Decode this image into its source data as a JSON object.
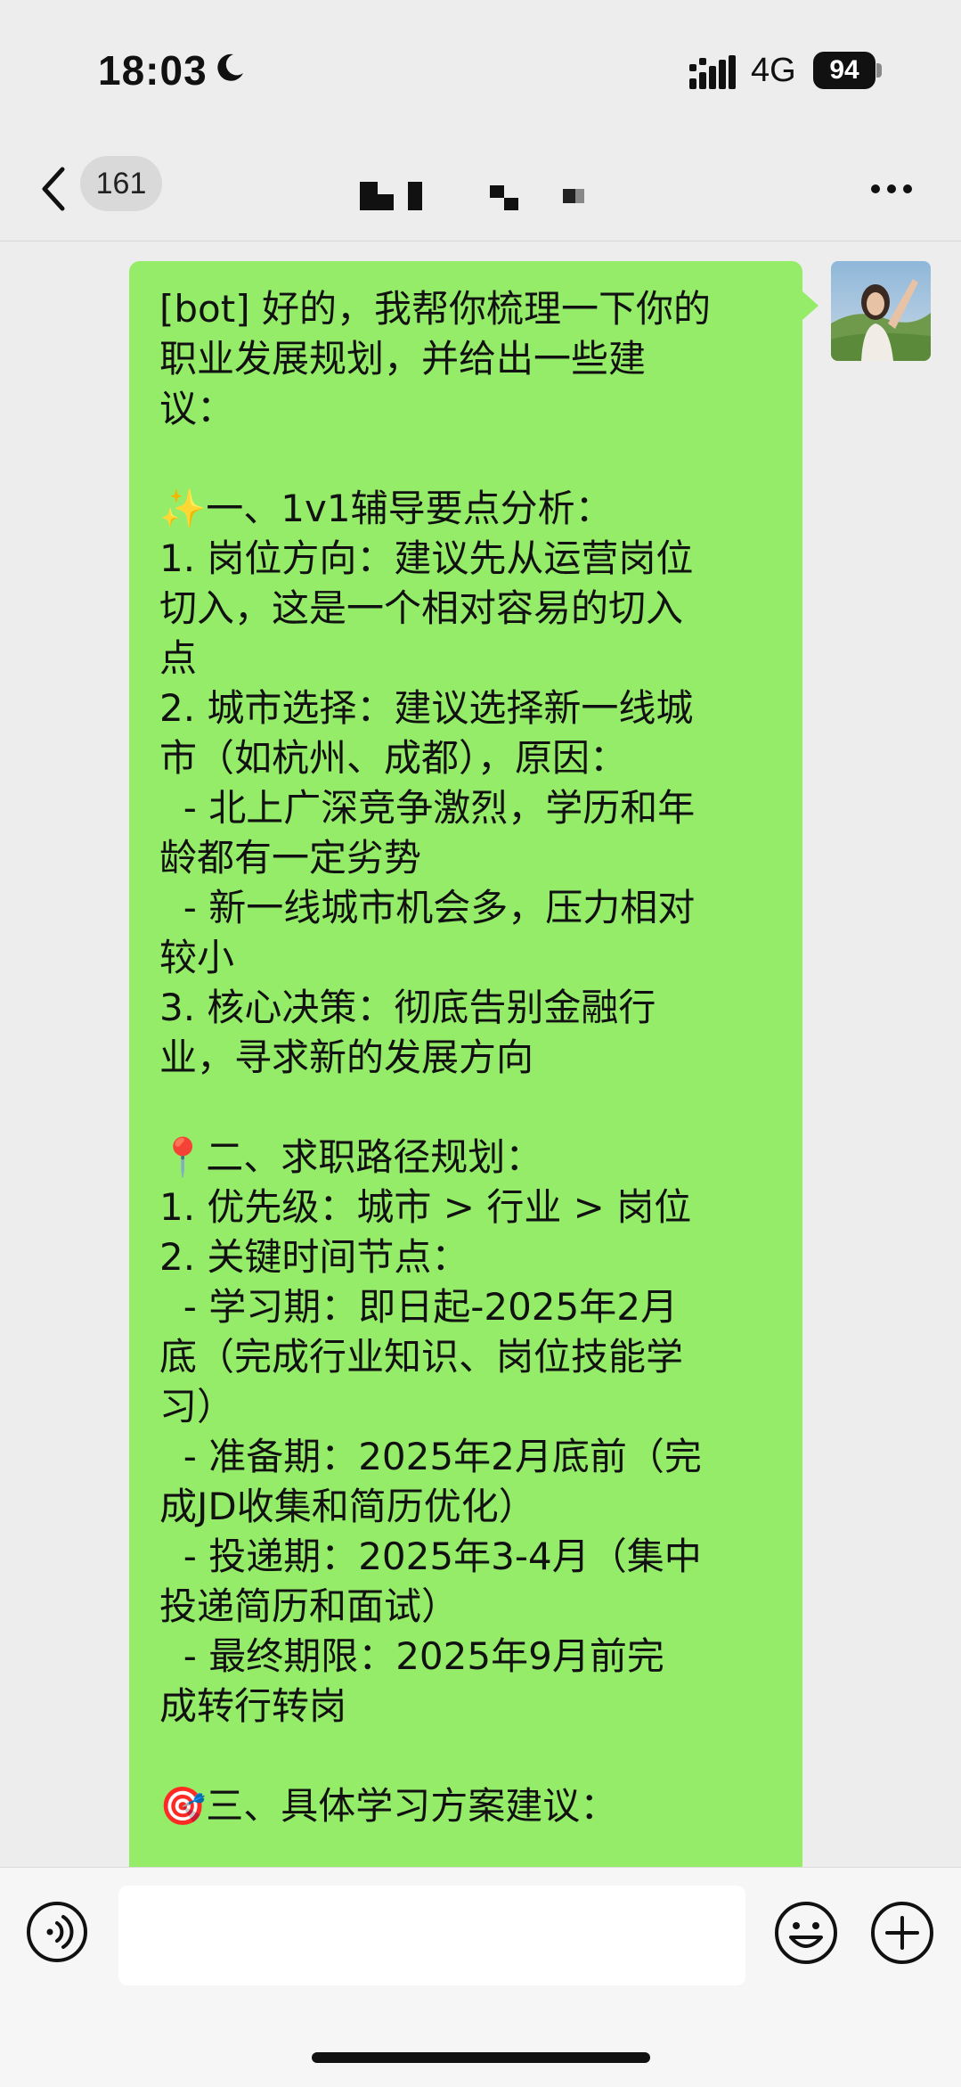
{
  "status_bar": {
    "time": "18:03",
    "network": "4G",
    "battery": "94"
  },
  "nav": {
    "unread_count": "161"
  },
  "message": {
    "lines": [
      "[bot] 好的，我帮你梳理一下你的",
      "职业发展规划，并给出一些建",
      "议：",
      "",
      "✨一、1v1辅导要点分析：",
      "1. 岗位方向：建议先从运营岗位",
      "切入，这是一个相对容易的切入",
      "点",
      "2. 城市选择：建议选择新一线城",
      "市（如杭州、成都），原因：",
      "  - 北上广深竞争激烈，学历和年",
      "龄都有一定劣势",
      "  - 新一线城市机会多，压力相对",
      "较小",
      "3. 核心决策：彻底告别金融行",
      "业，寻求新的发展方向",
      "",
      "📍二、求职路径规划：",
      "1. 优先级：城市 > 行业 > 岗位",
      "2. 关键时间节点：",
      "  - 学习期：即日起-2025年2月",
      "底（完成行业知识、岗位技能学",
      "习）",
      "  - 准备期：2025年2月底前（完",
      "成JD收集和简历优化）",
      "  - 投递期：2025年3-4月（集中",
      "投递简历和面试）",
      "  - 最终期限：2025年9月前完",
      "成转行转岗",
      "",
      "🎯三、具体学习方案建议："
    ]
  },
  "colors": {
    "bubble": "#95ec69",
    "background": "#ededed"
  }
}
